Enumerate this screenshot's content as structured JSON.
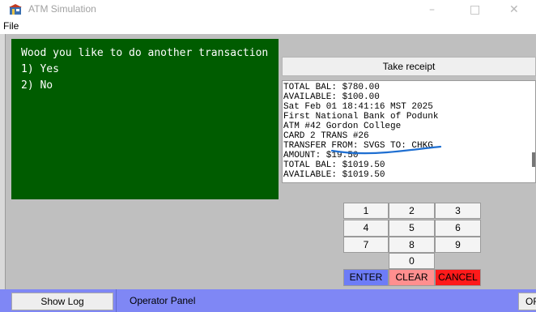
{
  "window": {
    "title": "ATM Simulation",
    "icon": "atm-app-icon",
    "controls": {
      "minimize": "–",
      "maximize": "□",
      "close": "✕"
    }
  },
  "menu": {
    "file": "File"
  },
  "screen": {
    "lines": [
      "Wood you like to do another transaction",
      "1) Yes",
      "2) No"
    ],
    "background": "#005c00",
    "text_color": "#ffffff"
  },
  "receipt": {
    "button_label": "Take receipt",
    "lines": [
      "TOTAL BAL: $780.00",
      "AVAILABLE: $100.00",
      "Sat Feb 01 18:41:16 MST 2025",
      "First National Bank of Podunk",
      "ATM #42 Gordon College",
      "CARD 2 TRANS #26",
      "TRANSFER FROM: SVGS TO: CHKG",
      "AMOUNT: $19.50",
      "TOTAL BAL: $1019.50",
      "AVAILABLE: $1019.50"
    ],
    "annotation_color": "#1f6fd1"
  },
  "keypad": {
    "digits": [
      "1",
      "2",
      "3",
      "4",
      "5",
      "6",
      "7",
      "8",
      "9",
      "0"
    ],
    "enter": "ENTER",
    "clear": "CLEAR",
    "cancel": "CANCEL",
    "colors": {
      "enter": "#6d7cf7",
      "clear": "#ff8f8f",
      "cancel": "#ff1a1a"
    }
  },
  "bottom_bar": {
    "show_log": "Show Log",
    "operator_panel": "Operator Panel",
    "off": "OFF",
    "background": "#7f87f5"
  }
}
